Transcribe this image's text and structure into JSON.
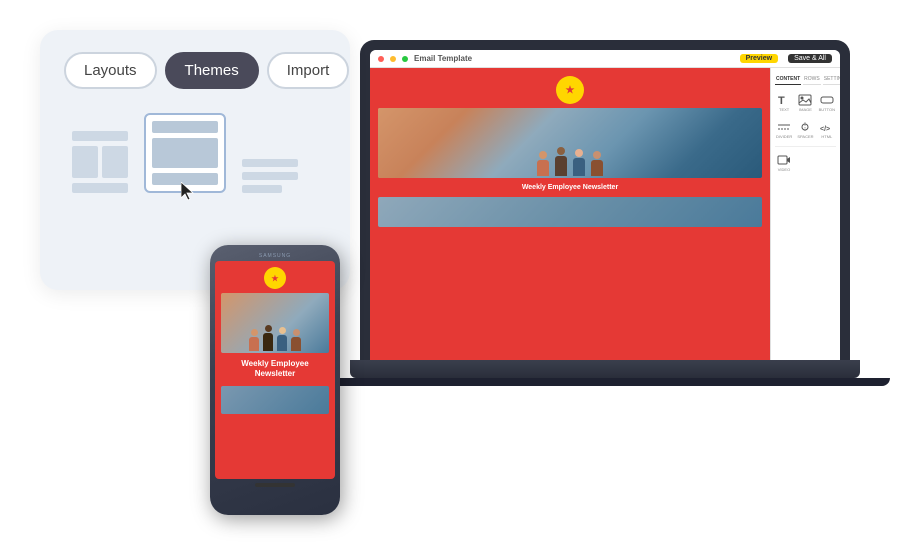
{
  "tabs": [
    {
      "id": "layouts",
      "label": "Layouts",
      "active": false
    },
    {
      "id": "themes",
      "label": "Themes",
      "active": true
    },
    {
      "id": "import",
      "label": "Import",
      "active": false
    }
  ],
  "layouts": [
    {
      "id": "two-col",
      "selected": false
    },
    {
      "id": "single-col",
      "selected": true
    },
    {
      "id": "text-only",
      "selected": false
    }
  ],
  "email_template": {
    "title": "Email Template",
    "newsletter_title": "Weekly Employee Newsletter",
    "badge_preview": "Preview",
    "badge_save": "Save & All"
  },
  "sidebar_tools": {
    "tabs": [
      "CONTENT",
      "ROWS",
      "SETTINGS"
    ],
    "active_tab": "CONTENT",
    "tools": [
      {
        "id": "text",
        "label": "TEXT"
      },
      {
        "id": "image",
        "label": "IMAGE"
      },
      {
        "id": "button",
        "label": "BUTTON"
      },
      {
        "id": "divider",
        "label": "DIVIDER"
      },
      {
        "id": "spacer",
        "label": "SPACER"
      },
      {
        "id": "html",
        "label": "HTML"
      },
      {
        "id": "video",
        "label": "VIDEO"
      }
    ]
  },
  "phone": {
    "brand": "SAMSUNG",
    "newsletter_title": "Weekly Employee\nNewsletter"
  }
}
